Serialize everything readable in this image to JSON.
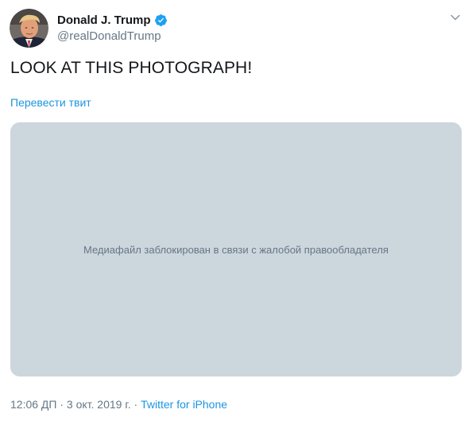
{
  "user": {
    "display_name": "Donald J. Trump",
    "handle": "@realDonaldTrump",
    "verified": true
  },
  "tweet": {
    "text": "LOOK AT THIS PHOTOGRAPH!",
    "translate_label": "Перевести твит",
    "media_message": "Медиафайл заблокирован в связи с жалобой правообладателя"
  },
  "footer": {
    "time": "12:06 ДП",
    "separator_1": " · ",
    "date": "3 окт. 2019 г.",
    "separator_2": " · ",
    "source": "Twitter for iPhone"
  },
  "colors": {
    "link": "#1b95e0",
    "verified_badge": "#1da1f2",
    "media_bg": "#ccd6dd",
    "secondary_text": "#657786"
  },
  "icons": {
    "verified": "verified-badge-icon",
    "menu": "chevron-down-icon"
  }
}
